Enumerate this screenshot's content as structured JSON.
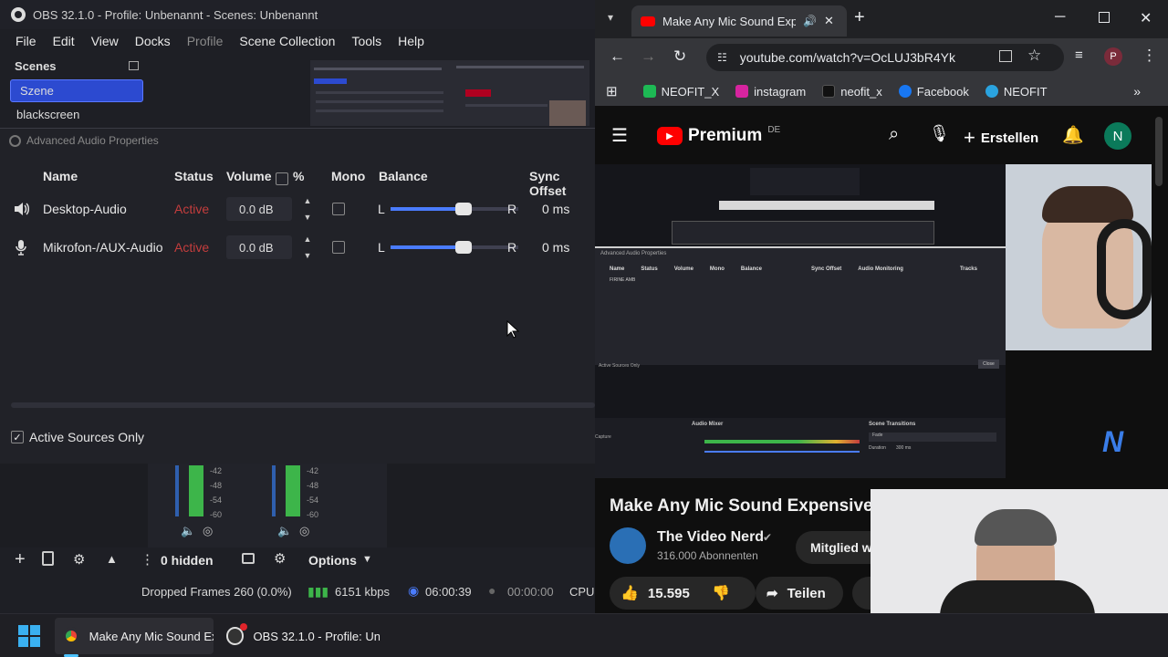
{
  "obs": {
    "title": "OBS 32.1.0 - Profile: Unbenannt - Scenes: Unbenannt",
    "menu": [
      "File",
      "Edit",
      "View",
      "Docks",
      "Profile",
      "Scene Collection",
      "Tools",
      "Help"
    ],
    "scenes": {
      "title": "Scenes",
      "items": [
        "Szene",
        "blackscreen"
      ]
    },
    "aap": {
      "title": "Advanced Audio Properties",
      "headers": {
        "name": "Name",
        "status": "Status",
        "volume": "Volume",
        "percent": "%",
        "mono": "Mono",
        "balance": "Balance",
        "sync": "Sync Offset"
      },
      "rows": [
        {
          "name": "Desktop-Audio",
          "status": "Active",
          "volume": "0.0 dB",
          "bal_l": "L",
          "bal_r": "R",
          "balance": 0.5,
          "sync": "0 ms"
        },
        {
          "name": "Mikrofon-/AUX-Audio",
          "status": "Active",
          "volume": "0.0 dB",
          "bal_l": "L",
          "bal_r": "R",
          "balance": 0.5,
          "sync": "0 ms"
        }
      ],
      "active_only": "Active Sources Only"
    },
    "meter_ticks": [
      "-42",
      "-48",
      "-54",
      "-60"
    ],
    "hidden": "0 hidden",
    "options": "Options",
    "status": {
      "dropped": "Dropped Frames 260 (0.0%)",
      "kbps": "6151 kbps",
      "live": "06:00:39",
      "rec": "00:00:00",
      "cpu": "CPU:"
    }
  },
  "chrome": {
    "tab_title": "Make Any Mic Sound Exper",
    "url": "youtube.com/watch?v=OcLUJ3bR4Yk",
    "profile": "P",
    "bookmarks": [
      "NEOFIT_X",
      "instagram",
      "neofit_x",
      "Facebook",
      "NEOFIT"
    ],
    "yt": {
      "logo": "Premium",
      "region": "DE",
      "create": "Erstellen",
      "avatar": "N",
      "video_title": "Make Any Mic Sound Expensive",
      "channel": "The Video Nerd",
      "subs": "316.000 Abonnenten",
      "join": "Mitglied we",
      "likes": "15.595",
      "share": "Teilen",
      "embedded": {
        "dialog_title": "Advanced Audio Properties",
        "cols": [
          "Name",
          "Status",
          "Volume",
          "Mono",
          "Balance",
          "Sync Offset",
          "Audio Monitoring",
          "Tracks"
        ],
        "row": "FIRINE AMB",
        "active_only": "Active Sources Only",
        "close": "Close",
        "mixer": "Audio Mixer",
        "transitions": "Scene Transitions",
        "fade": "Fade",
        "duration": "Duration",
        "duration_val": "300 ms",
        "capture": "Capture"
      }
    }
  },
  "taskbar": {
    "items": [
      "Make Any Mic Sound Ex",
      "OBS 32.1.0 - Profile: Unt"
    ]
  }
}
